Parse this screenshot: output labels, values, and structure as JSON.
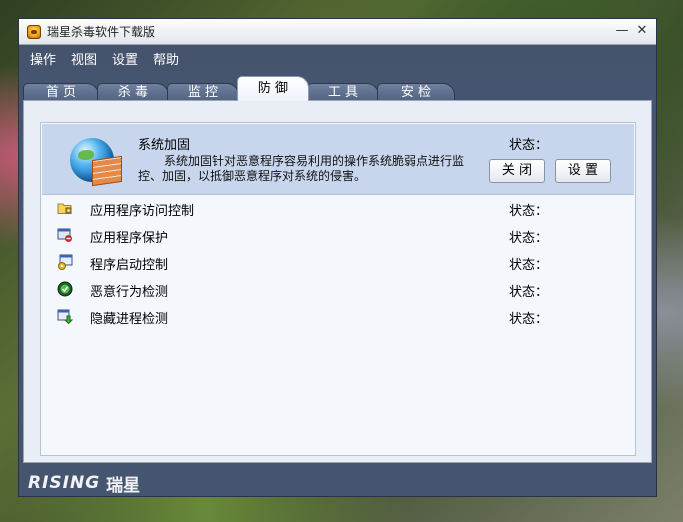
{
  "window": {
    "title": "瑞星杀毒软件下载版",
    "minimize": "—",
    "close": "✕"
  },
  "menu": [
    "操作",
    "视图",
    "设置",
    "帮助"
  ],
  "tabs": [
    {
      "label": "首 页",
      "active": false
    },
    {
      "label": "杀 毒",
      "active": false
    },
    {
      "label": "监 控",
      "active": false
    },
    {
      "label": "防 御",
      "active": true
    },
    {
      "label": "工 具",
      "active": false
    },
    {
      "label": "安 检",
      "active": false
    }
  ],
  "highlight": {
    "title": "系统加固",
    "description": "系统加固针对恶意程序容易利用的操作系统脆弱点进行监控、加固，以抵御恶意程序对系统的侵害。",
    "status_label": "状态：",
    "close_button": "关 闭",
    "settings_button": "设 置",
    "icon": "globe-firewall-icon"
  },
  "items": [
    {
      "label": "应用程序访问控制",
      "status_label": "状态：",
      "icon": "folder-lock-icon"
    },
    {
      "label": "应用程序保护",
      "status_label": "状态：",
      "icon": "app-block-icon"
    },
    {
      "label": "程序启动控制",
      "status_label": "状态：",
      "icon": "startup-control-icon"
    },
    {
      "label": "恶意行为检测",
      "status_label": "状态：",
      "icon": "behavior-detect-icon"
    },
    {
      "label": "隐藏进程检测",
      "status_label": "状态：",
      "icon": "hidden-process-icon"
    }
  ],
  "footer": {
    "brand_en": "RISING",
    "brand_cn": "瑞星"
  }
}
